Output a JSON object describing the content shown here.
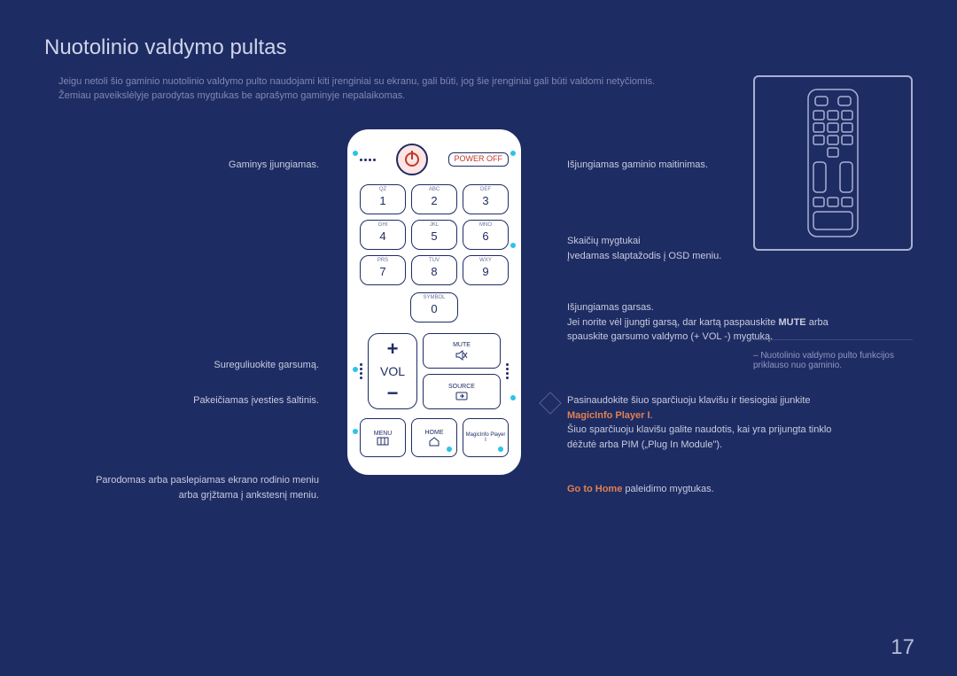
{
  "title": "Nuotolinio valdymo pultas",
  "notes": [
    "Jeigu netoli šio gaminio nuotolinio valdymo pulto naudojami kiti įrenginiai su ekranu, gali būti, jog šie įrenginiai gali būti valdomi netyčiomis.",
    "Žemiau paveikslėlyje parodytas mygtukas be aprašymo gaminyje nepalaikomas."
  ],
  "left": {
    "power_on": "Gaminys įjungiamas.",
    "volume": "Sureguliuokite garsumą.",
    "source": "Pakeičiamas įvesties šaltinis.",
    "menu_full": "Parodomas arba paslepiamas ekrano rodinio meniu arba grįžtama į ankstesnį meniu."
  },
  "right": {
    "power_off": "Išjungiamas gaminio maitinimas.",
    "numbers_title": "Skaičių mygtukai",
    "numbers_body": "Įvedamas slaptažodis į OSD meniu.",
    "mute_title": "Išjungiamas garsas.",
    "mute_body_a": "Jei norite vėl įjungti garsą, dar kartą paspauskite ",
    "mute_bold": "MUTE",
    "mute_body_b": " arba spauskite garsumo valdymo (+ VOL -) mygtuką.",
    "magic_a": "Pasinaudokite šiuo sparčiuoju klavišu ir tiesiogiai įjunkite ",
    "magic_link": "MagicInfo Player I",
    "magic_b": ".",
    "magic_c": "Šiuo sparčiuoju klavišu galite naudotis, kai yra prijungta tinklo dėžutė arba PIM („Plug In Module\").",
    "home_a": "Go to Home",
    "home_b": " paleidimo mygtukas."
  },
  "remote": {
    "power_off_label": "POWER OFF",
    "keys": [
      {
        "sub": "QZ",
        "num": "1"
      },
      {
        "sub": "ABC",
        "num": "2"
      },
      {
        "sub": "DEF",
        "num": "3"
      },
      {
        "sub": "GHI",
        "num": "4"
      },
      {
        "sub": "JKL",
        "num": "5"
      },
      {
        "sub": "MNO",
        "num": "6"
      },
      {
        "sub": "PRS",
        "num": "7"
      },
      {
        "sub": "TUV",
        "num": "8"
      },
      {
        "sub": "WXY",
        "num": "9"
      }
    ],
    "symbol": "SYMBOL",
    "zero": "0",
    "vol": "VOL",
    "mute": "MUTE",
    "source": "SOURCE",
    "menu": "MENU",
    "home": "HOME",
    "magic": "MagicInfo Player I"
  },
  "side_note": "– Nuotolinio valdymo pulto funkcijos priklauso nuo gaminio.",
  "page_number": "17"
}
